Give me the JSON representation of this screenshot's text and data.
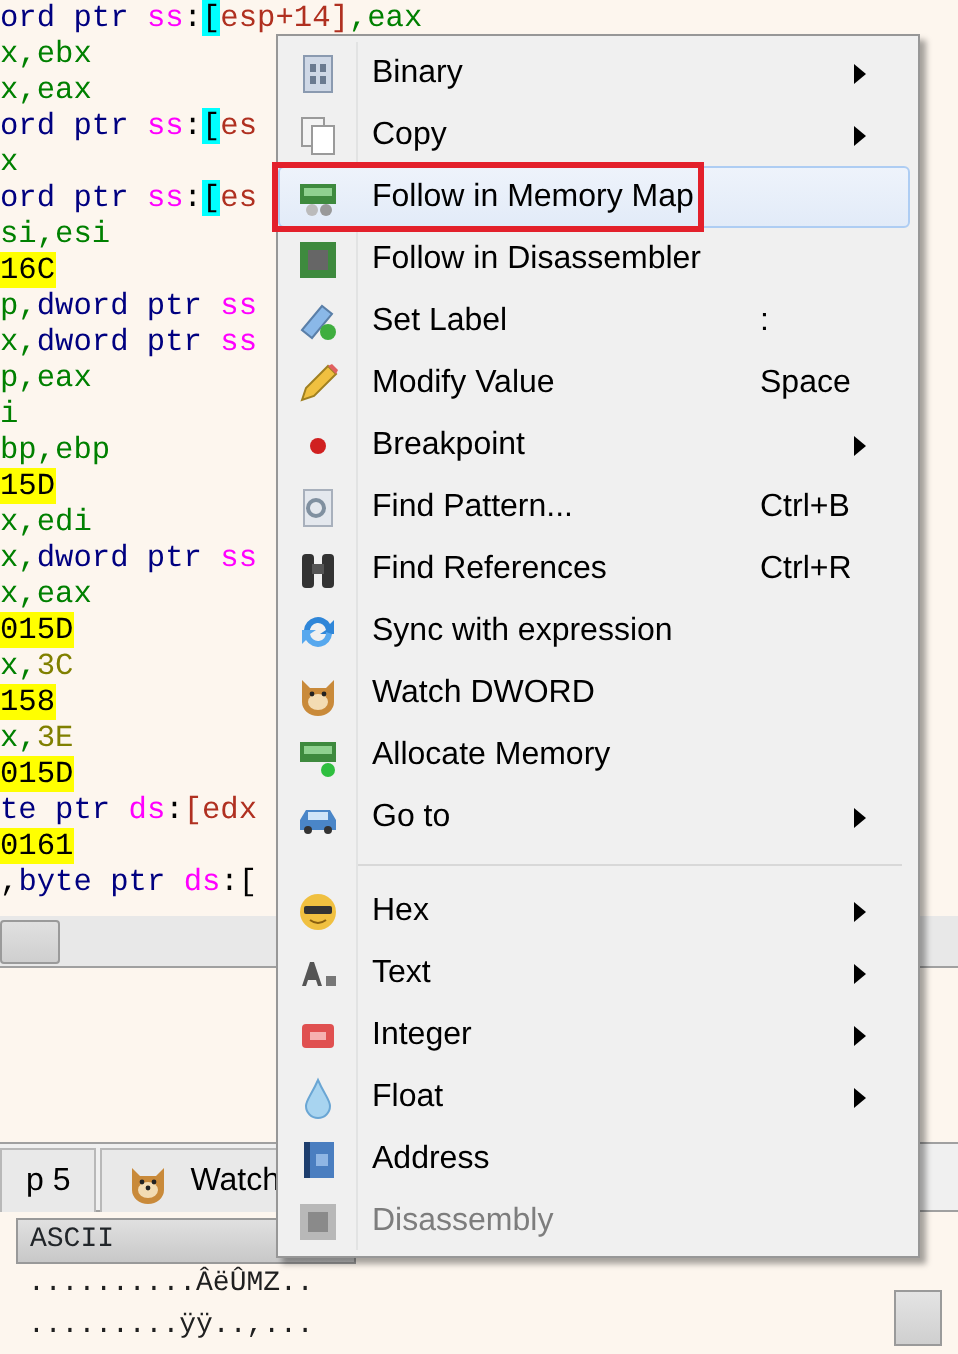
{
  "code_lines": [
    {
      "tokens": [
        {
          "text": "ord ptr ",
          "kind": "keyword"
        },
        {
          "text": "ss",
          "kind": "segment"
        },
        {
          "text": ":",
          "kind": "plain"
        },
        {
          "text": "[",
          "kind": "bracket"
        },
        {
          "text": "esp+14]",
          "kind": "memory"
        },
        {
          "text": ",eax",
          "kind": "register"
        }
      ]
    },
    {
      "tokens": [
        {
          "text": "x,ebx",
          "kind": "register"
        }
      ]
    },
    {
      "tokens": [
        {
          "text": "x,eax",
          "kind": "register"
        }
      ]
    },
    {
      "tokens": [
        {
          "text": "ord ptr ",
          "kind": "keyword"
        },
        {
          "text": "ss",
          "kind": "segment"
        },
        {
          "text": ":",
          "kind": "plain"
        },
        {
          "text": "[",
          "kind": "bracket"
        },
        {
          "text": "es",
          "kind": "memory"
        }
      ]
    },
    {
      "tokens": [
        {
          "text": "x",
          "kind": "register"
        }
      ]
    },
    {
      "tokens": [
        {
          "text": "ord ptr ",
          "kind": "keyword"
        },
        {
          "text": "ss",
          "kind": "segment"
        },
        {
          "text": ":",
          "kind": "plain"
        },
        {
          "text": "[",
          "kind": "bracket"
        },
        {
          "text": "es",
          "kind": "memory"
        }
      ]
    },
    {
      "tokens": [
        {
          "text": "si,esi",
          "kind": "register"
        }
      ]
    },
    {
      "tokens": [
        {
          "text": "16C",
          "kind": "address"
        }
      ]
    },
    {
      "tokens": [
        {
          "text": "p,",
          "kind": "register"
        },
        {
          "text": "dword ptr ",
          "kind": "keyword"
        },
        {
          "text": "ss",
          "kind": "segment"
        }
      ]
    },
    {
      "tokens": [
        {
          "text": "x,",
          "kind": "register"
        },
        {
          "text": "dword ptr ",
          "kind": "keyword"
        },
        {
          "text": "ss",
          "kind": "segment"
        }
      ]
    },
    {
      "tokens": [
        {
          "text": "p,eax",
          "kind": "register"
        }
      ]
    },
    {
      "tokens": [
        {
          "text": "i",
          "kind": "register"
        }
      ]
    },
    {
      "tokens": [
        {
          "text": "bp,ebp",
          "kind": "register"
        }
      ]
    },
    {
      "tokens": [
        {
          "text": "15D",
          "kind": "address"
        }
      ]
    },
    {
      "tokens": [
        {
          "text": "x,edi",
          "kind": "register"
        }
      ]
    },
    {
      "tokens": [
        {
          "text": "x,",
          "kind": "register"
        },
        {
          "text": "dword ptr ",
          "kind": "keyword"
        },
        {
          "text": "ss",
          "kind": "segment"
        }
      ]
    },
    {
      "tokens": [
        {
          "text": "x,eax",
          "kind": "register"
        }
      ]
    },
    {
      "tokens": [
        {
          "text": "015D",
          "kind": "address"
        }
      ]
    },
    {
      "tokens": [
        {
          "text": "x,",
          "kind": "register"
        },
        {
          "text": "3C",
          "kind": "number"
        }
      ]
    },
    {
      "tokens": [
        {
          "text": "158",
          "kind": "address"
        }
      ]
    },
    {
      "tokens": [
        {
          "text": "x,",
          "kind": "register"
        },
        {
          "text": "3E",
          "kind": "number"
        }
      ]
    },
    {
      "tokens": [
        {
          "text": "015D",
          "kind": "address"
        }
      ]
    },
    {
      "tokens": [
        {
          "text": "te ptr ",
          "kind": "keyword"
        },
        {
          "text": "ds",
          "kind": "segment"
        },
        {
          "text": ":",
          "kind": "plain"
        },
        {
          "text": "[edx",
          "kind": "memory"
        }
      ]
    },
    {
      "tokens": [
        {
          "text": "0161",
          "kind": "address"
        }
      ]
    },
    {
      "tokens": [
        {
          "text": ",",
          "kind": "plain"
        },
        {
          "text": "byte ptr ",
          "kind": "keyword"
        },
        {
          "text": "ds",
          "kind": "segment"
        },
        {
          "text": ":[",
          "kind": "plain"
        }
      ]
    }
  ],
  "tabs": [
    {
      "label": "p 5",
      "selected": false
    },
    {
      "label": "Watch",
      "selected": false
    }
  ],
  "dump": {
    "columns": [
      "ASCII"
    ],
    "rows": [
      "..........ÂëÛMZ..",
      ".........ÿÿ..,..."
    ]
  },
  "context_menu": {
    "items": [
      {
        "kind": "item",
        "label": "Binary",
        "submenu": true,
        "selected": false,
        "disabled": false
      },
      {
        "kind": "item",
        "label": "Copy",
        "submenu": true,
        "selected": false,
        "disabled": false
      },
      {
        "kind": "item",
        "label": "Follow in Memory Map",
        "submenu": false,
        "selected": true,
        "disabled": false,
        "annotated": true
      },
      {
        "kind": "item",
        "label": "Follow in Disassembler",
        "submenu": false,
        "selected": false,
        "disabled": false
      },
      {
        "kind": "item",
        "label": "Set Label",
        "shortcut": ":",
        "submenu": false,
        "selected": false,
        "disabled": false
      },
      {
        "kind": "item",
        "label": "Modify Value",
        "shortcut": "Space",
        "submenu": false,
        "selected": false,
        "disabled": false
      },
      {
        "kind": "item",
        "label": "Breakpoint",
        "submenu": true,
        "selected": false,
        "disabled": false
      },
      {
        "kind": "item",
        "label": "Find Pattern...",
        "shortcut": "Ctrl+B",
        "submenu": false,
        "selected": false,
        "disabled": false
      },
      {
        "kind": "item",
        "label": "Find References",
        "shortcut": "Ctrl+R",
        "submenu": false,
        "selected": false,
        "disabled": false
      },
      {
        "kind": "item",
        "label": "Sync with expression",
        "submenu": false,
        "selected": false,
        "disabled": false
      },
      {
        "kind": "item",
        "label": "Watch DWORD",
        "submenu": false,
        "selected": false,
        "disabled": false
      },
      {
        "kind": "item",
        "label": "Allocate Memory",
        "submenu": false,
        "selected": false,
        "disabled": false
      },
      {
        "kind": "item",
        "label": "Go to",
        "submenu": true,
        "selected": false,
        "disabled": false
      },
      {
        "kind": "separator"
      },
      {
        "kind": "item",
        "label": "Hex",
        "submenu": true,
        "selected": false,
        "disabled": false
      },
      {
        "kind": "item",
        "label": "Text",
        "submenu": true,
        "selected": false,
        "disabled": false
      },
      {
        "kind": "item",
        "label": "Integer",
        "submenu": true,
        "selected": false,
        "disabled": false
      },
      {
        "kind": "item",
        "label": "Float",
        "submenu": true,
        "selected": false,
        "disabled": false
      },
      {
        "kind": "item",
        "label": "Address",
        "submenu": false,
        "selected": false,
        "disabled": false
      },
      {
        "kind": "item",
        "label": "Disassembly",
        "submenu": false,
        "selected": false,
        "disabled": true
      }
    ]
  }
}
